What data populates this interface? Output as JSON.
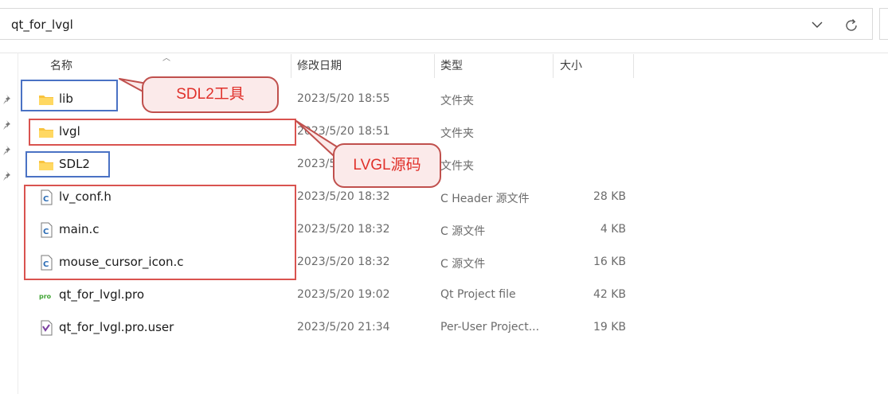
{
  "address": {
    "path": "qt_for_lvgl"
  },
  "columns": {
    "name": "名称",
    "modified": "修改日期",
    "type": "类型",
    "size": "大小"
  },
  "files": [
    {
      "name": "lib",
      "modified": "2023/5/20 18:55",
      "type": "文件夹",
      "size": "",
      "icon": "folder-icon"
    },
    {
      "name": "lvgl",
      "modified": "2023/5/20 18:51",
      "type": "文件夹",
      "size": "",
      "icon": "folder-icon"
    },
    {
      "name": "SDL2",
      "modified": "2023/5",
      "type": "文件夹",
      "size": "",
      "icon": "folder-icon"
    },
    {
      "name": "lv_conf.h",
      "modified": "2023/5/20 18:32",
      "type": "C Header 源文件",
      "size": "28 KB",
      "icon": "c-header-file-icon"
    },
    {
      "name": "main.c",
      "modified": "2023/5/20 18:32",
      "type": "C 源文件",
      "size": "4 KB",
      "icon": "c-source-file-icon"
    },
    {
      "name": "mouse_cursor_icon.c",
      "modified": "2023/5/20 18:32",
      "type": "C 源文件",
      "size": "16 KB",
      "icon": "c-source-file-icon"
    },
    {
      "name": "qt_for_lvgl.pro",
      "modified": "2023/5/20 19:02",
      "type": "Qt Project file",
      "size": "42 KB",
      "icon": "qt-project-file-icon"
    },
    {
      "name": "qt_for_lvgl.pro.user",
      "modified": "2023/5/20 21:34",
      "type": "Per-User Project...",
      "size": "19 KB",
      "icon": "qt-user-file-icon"
    }
  ],
  "annotations": {
    "sdl2_tools": "SDL2工具",
    "lvgl_source": "LVGL源码"
  },
  "colors": {
    "folder": "#f8c33e",
    "blue_box": "#4a72c4",
    "red_box": "#d9534f",
    "callout_text": "#e0302a"
  }
}
